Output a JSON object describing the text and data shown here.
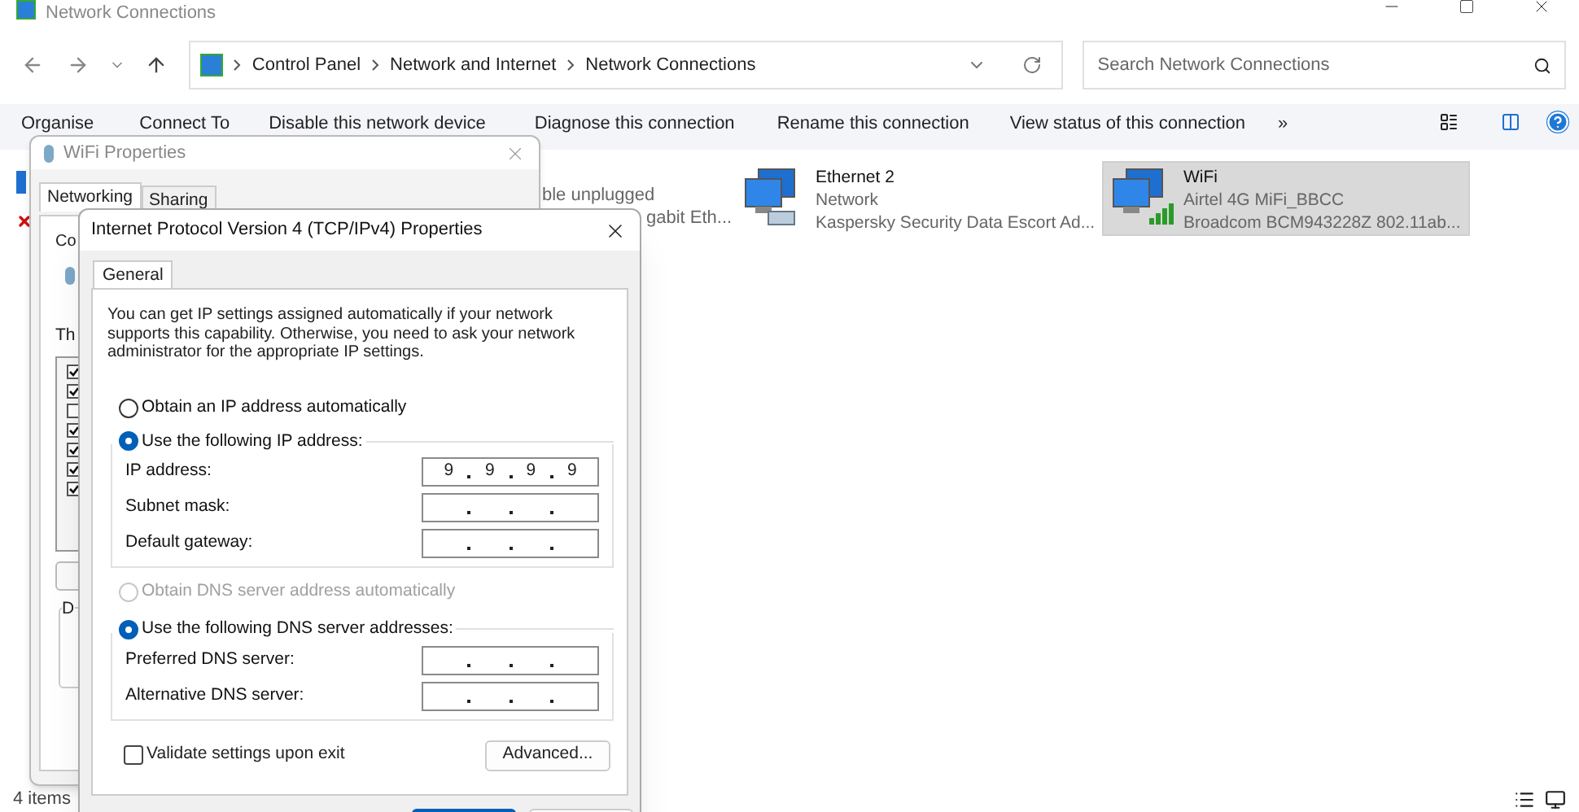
{
  "window": {
    "title": "Network Connections"
  },
  "address_bar": {
    "breadcrumbs": [
      "Control Panel",
      "Network and Internet",
      "Network Connections"
    ]
  },
  "search": {
    "placeholder": "Search Network Connections"
  },
  "toolbar": {
    "items": [
      "Organise",
      "Connect To",
      "Disable this network device",
      "Diagnose this connection",
      "Rename this connection",
      "View status of this connection",
      "»"
    ]
  },
  "connections": [
    {
      "kind": "fragment",
      "lines": [
        "ble unplugged",
        "gabit Eth..."
      ]
    },
    {
      "kind": "ethernet",
      "name": "Ethernet 2",
      "selected": false,
      "lines": [
        "Network",
        "Kaspersky Security Data Escort Ad..."
      ]
    },
    {
      "kind": "wifi",
      "name": "WiFi",
      "selected": true,
      "lines": [
        "Airtel 4G MiFi_BBCC",
        "Broadcom BCM943228Z 802.11ab..."
      ]
    }
  ],
  "status_bar": {
    "count": "4 items"
  },
  "wifi_properties": {
    "title": "WiFi Properties",
    "tabs": [
      {
        "label": "Networking",
        "selected": true
      },
      {
        "label": "Sharing",
        "selected": false
      }
    ],
    "fragments": [
      "Co",
      "Th",
      "D"
    ],
    "components": [
      {
        "checked": true
      },
      {
        "checked": true
      },
      {
        "checked": false
      },
      {
        "checked": true
      },
      {
        "checked": true
      },
      {
        "checked": true
      },
      {
        "checked": true
      }
    ]
  },
  "ipv4_dialog": {
    "title": "Internet Protocol Version 4 (TCP/IPv4) Properties",
    "tabs": [
      {
        "label": "General",
        "selected": true
      }
    ],
    "description": "You can get IP settings assigned automatically if your network supports this capability. Otherwise, you need to ask your network administrator for the appropriate IP settings.",
    "ip_options": [
      {
        "label": "Obtain an IP address automatically",
        "selected": false,
        "disabled": false
      },
      {
        "label": "Use the following IP address:",
        "selected": true,
        "disabled": false
      }
    ],
    "ip_fields": [
      {
        "label": "IP address:",
        "octets": [
          "9",
          "9",
          "9",
          "9"
        ]
      },
      {
        "label": "Subnet mask:"
      },
      {
        "label": "Default gateway:"
      }
    ],
    "dns_options": [
      {
        "label": "Obtain DNS server address automatically",
        "selected": false,
        "disabled": true
      },
      {
        "label": "Use the following DNS server addresses:",
        "selected": true,
        "disabled": false
      }
    ],
    "dns_fields": [
      {
        "label": "Preferred DNS server:"
      },
      {
        "label": "Alternative DNS server:"
      }
    ],
    "validate": {
      "label": "Validate settings upon exit",
      "checked": false
    },
    "advanced_button": "Advanced..."
  }
}
